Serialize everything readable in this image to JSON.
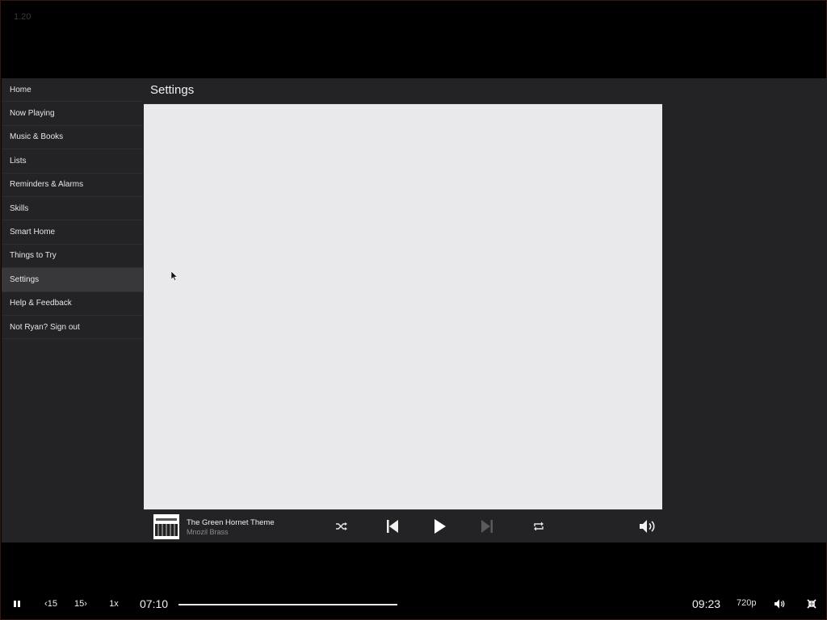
{
  "version": "1.20",
  "sidebar": {
    "items": [
      {
        "label": "Home"
      },
      {
        "label": "Now Playing"
      },
      {
        "label": "Music & Books"
      },
      {
        "label": "Lists"
      },
      {
        "label": "Reminders & Alarms"
      },
      {
        "label": "Skills"
      },
      {
        "label": "Smart Home"
      },
      {
        "label": "Things to Try"
      },
      {
        "label": "Settings"
      },
      {
        "label": "Help & Feedback"
      },
      {
        "label": "Not Ryan? Sign out"
      }
    ],
    "active_index": 8
  },
  "header": {
    "title": "Settings"
  },
  "player": {
    "track_title": "The Green Hornet Theme",
    "artist": "Mnozil Brass",
    "album_art_icon": "album-cover",
    "buttons": {
      "shuffle": "shuffle-icon",
      "previous": "previous-track-icon",
      "play": "play-icon",
      "next": "next-track-icon",
      "repeat": "repeat-icon",
      "volume": "volume-icon"
    }
  },
  "video_controls": {
    "pause_icon": "pause-icon",
    "rewind_label": "15",
    "forward_label": "15",
    "speed_label": "1x",
    "time_current": "07:10",
    "time_total": "09:23",
    "progress": 0.4318,
    "quality_label": "720p",
    "volume_icon": "volume-icon",
    "exit_fullscreen_icon": "exit-fullscreen-icon"
  },
  "colors": {
    "background": "#000000",
    "panel": "#232325",
    "active_nav": "#38383b",
    "content": "#e9e8eb"
  }
}
